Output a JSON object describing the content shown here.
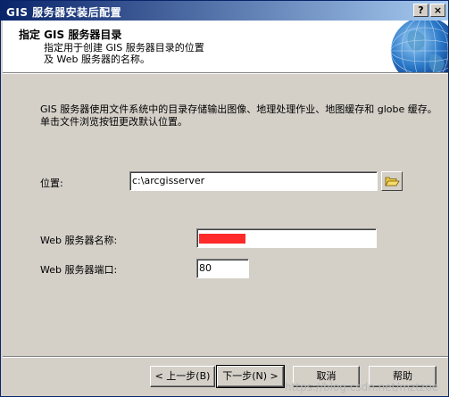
{
  "window": {
    "title": "GIS 服务器安装后配置",
    "help_button": "?",
    "close_button": "×"
  },
  "header": {
    "title": "指定 GIS 服务器目录",
    "subtitle": "指定用于创建 GIS 服务器目录的位置\n及 Web 服务器的名称。"
  },
  "description": "GIS 服务器使用文件系统中的目录存储输出图像、地理处理作业、地图缓存和 globe 缓存。单击文件浏览按钮更改默认位置。",
  "location": {
    "label": "位置:",
    "value": "c:\\arcgisserver"
  },
  "web_server": {
    "name_label": "Web 服务器名称:",
    "name_value": "",
    "port_label": "Web 服务器端口:",
    "port_value": "80"
  },
  "buttons": {
    "back": "< 上一步(B)",
    "next": "下一步(N) >",
    "cancel": "取消",
    "help": "帮助"
  },
  "watermark": "https://blog.csdn.net/mztzoe"
}
